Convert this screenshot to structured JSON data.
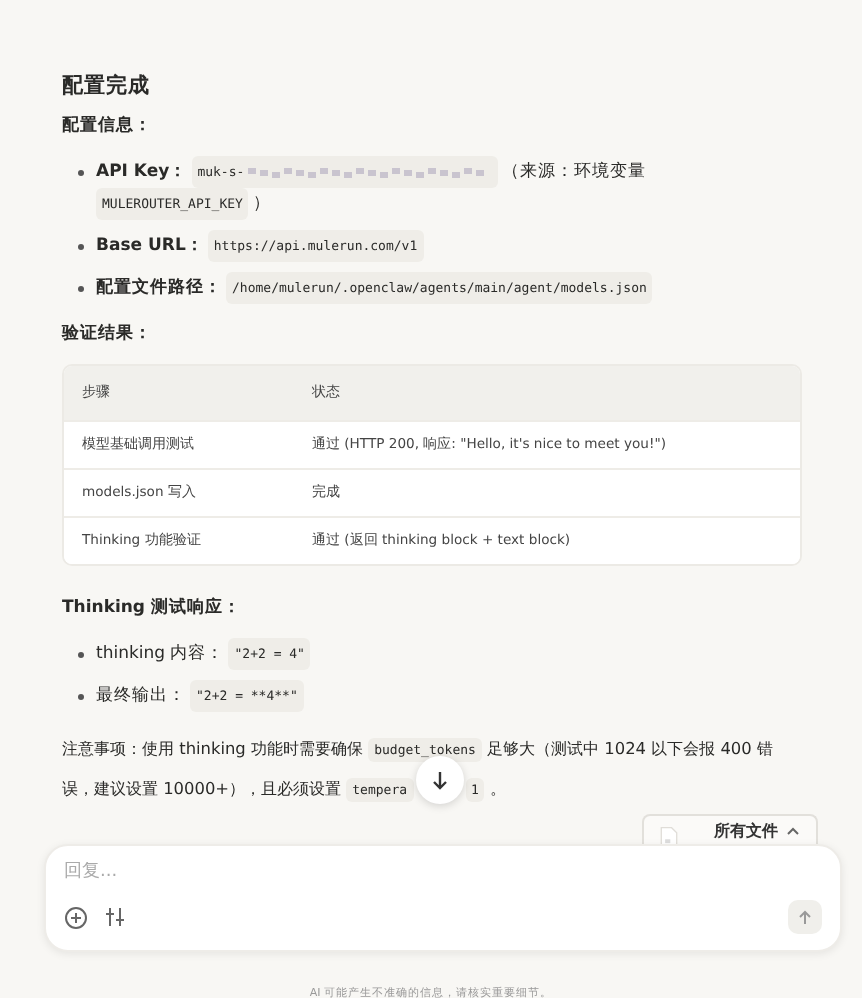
{
  "heading": "配置完成",
  "config_title": "配置信息：",
  "config_items": [
    {
      "label": "API Key",
      "sep": "：",
      "code": "muk-s-",
      "redacted": true,
      "after": "（来源：环境变量",
      "code2": "MULEROUTER_API_KEY",
      "after2": "）"
    },
    {
      "label": "Base URL",
      "sep": "：",
      "code": "https://api.mulerun.com/v1"
    },
    {
      "label": "配置文件路径",
      "sep": "：",
      "code": "/home/mulerun/.openclaw/agents/main/agent/models.json"
    }
  ],
  "verify_title": "验证结果：",
  "table": {
    "columns": [
      "步骤",
      "状态"
    ],
    "rows": [
      [
        "模型基础调用测试",
        "通过 (HTTP 200, 响应: \"Hello, it's nice to meet you!\")"
      ],
      [
        "models.json 写入",
        "完成"
      ],
      [
        "Thinking 功能验证",
        "通过 (返回 thinking block + text block)"
      ]
    ]
  },
  "thinking_title": "Thinking 测试响应：",
  "thinking_items": [
    {
      "label": "thinking 内容：",
      "code": "\"2+2 = 4\""
    },
    {
      "label": "最终输出：",
      "code": "\"2+2 = **4**\""
    }
  ],
  "note": [
    {
      "kind": "text",
      "text": "注意事项：使用 thinking 功能时需要确保 "
    },
    {
      "kind": "code",
      "text": "budget_tokens"
    },
    {
      "kind": "text",
      "text": " 足够大（测试中 1024 以下会报 400 错误，建议设置 10000+），且必须设置 "
    },
    {
      "kind": "code",
      "text": "tempera"
    },
    {
      "kind": "gap"
    },
    {
      "kind": "code",
      "text": "1"
    },
    {
      "kind": "text",
      "text": " 。"
    }
  ],
  "files_chip": {
    "label": "所有文件"
  },
  "composer": {
    "placeholder": "回复..."
  },
  "footer": "AI 可能产生不准确的信息，请核实重要细节。"
}
